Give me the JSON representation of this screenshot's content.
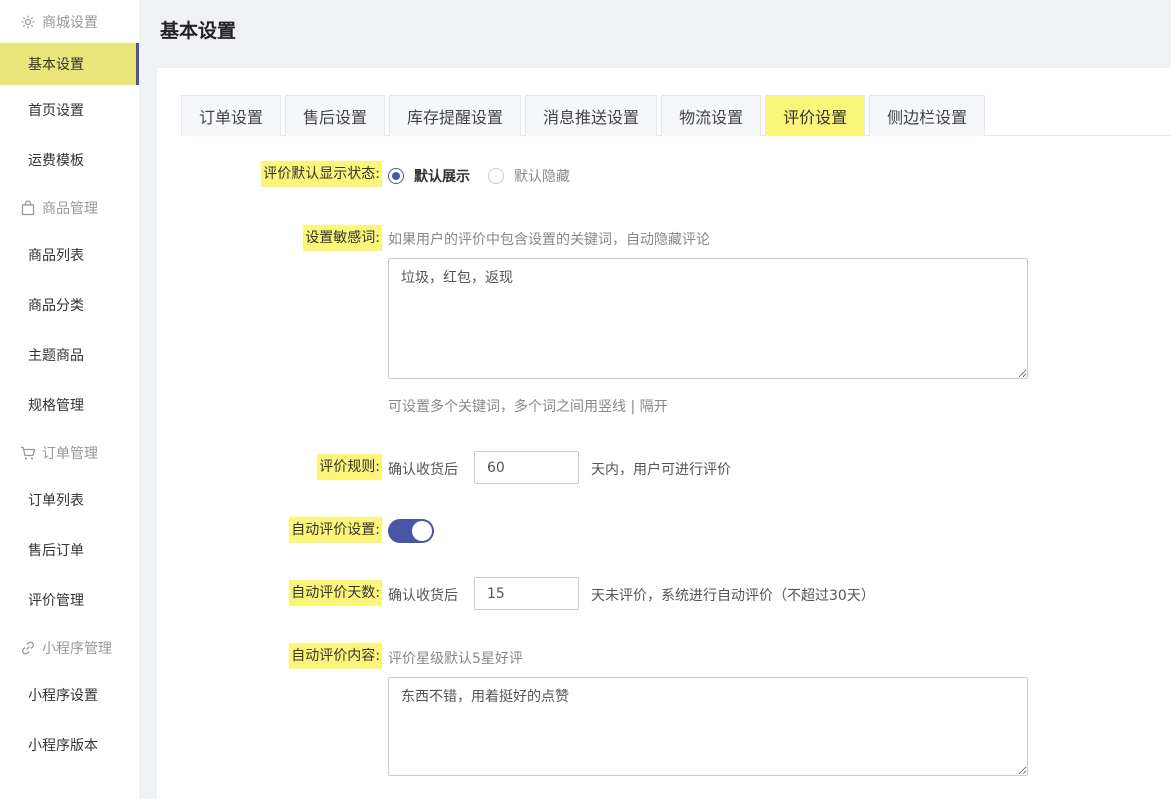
{
  "sidebar": {
    "groups": [
      {
        "title": "商城设置",
        "icon": "gear-icon",
        "items": [
          "基本设置",
          "首页设置",
          "运费模板"
        ]
      },
      {
        "title": "商品管理",
        "icon": "bag-icon",
        "items": [
          "商品列表",
          "商品分类",
          "主题商品",
          "规格管理"
        ]
      },
      {
        "title": "订单管理",
        "icon": "cart-icon",
        "items": [
          "订单列表",
          "售后订单",
          "评价管理"
        ]
      },
      {
        "title": "小程序管理",
        "icon": "link-icon",
        "items": [
          "小程序设置",
          "小程序版本"
        ]
      }
    ],
    "active_item": "基本设置"
  },
  "header": {
    "title": "基本设置"
  },
  "tabs": {
    "items": [
      "订单设置",
      "售后设置",
      "库存提醒设置",
      "消息推送设置",
      "物流设置",
      "评价设置",
      "侧边栏设置"
    ],
    "active": "评价设置"
  },
  "form": {
    "display_status": {
      "label": "评价默认显示状态:",
      "option_show": "默认展示",
      "option_hide": "默认隐藏",
      "selected": "默认展示"
    },
    "sensitive_words": {
      "label": "设置敏感词:",
      "hint": "如果用户的评价中包含设置的关键词，自动隐藏评论",
      "value": "垃圾，红包，返现",
      "help": "可设置多个关键词，多个词之间用竖线 | 隔开"
    },
    "review_rule": {
      "label": "评价规则:",
      "prefix": "确认收货后",
      "value": "60",
      "suffix": "天内，用户可进行评价"
    },
    "auto_review": {
      "label": "自动评价设置:",
      "enabled": true
    },
    "auto_review_days": {
      "label": "自动评价天数:",
      "prefix": "确认收货后",
      "value": "15",
      "suffix": "天未评价，系统进行自动评价（不超过30天）"
    },
    "auto_review_content": {
      "label": "自动评价内容:",
      "hint": "评价星级默认5星好评",
      "value": "东西不错，用着挺好的点赞"
    }
  },
  "colors": {
    "accent": "#4a55a6",
    "highlight": "#fbf57a",
    "active_sidebar": "#ebe67a"
  }
}
